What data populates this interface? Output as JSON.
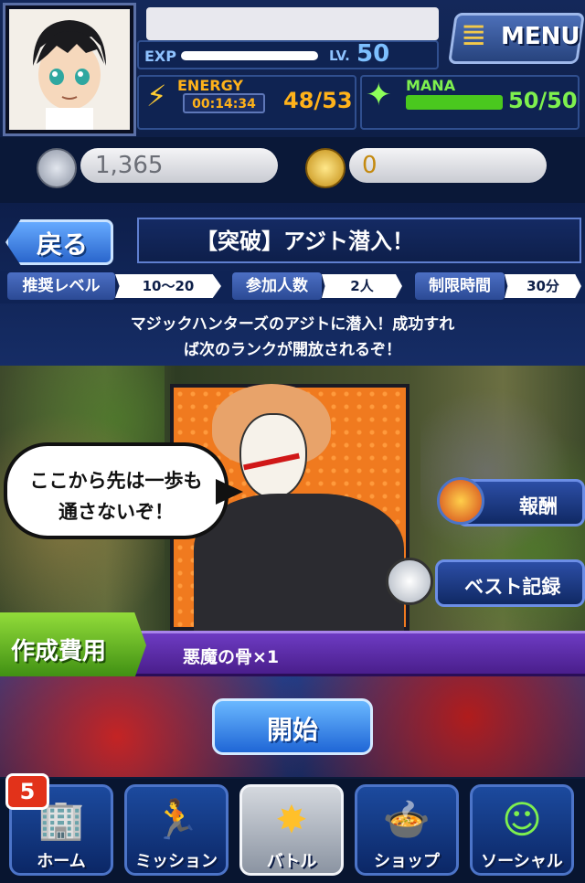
{
  "status": {
    "exp_label": "EXP",
    "level_label": "LV.",
    "level": "50",
    "energy_label": "ENERGY",
    "energy_timer": "00:14:34",
    "energy_value": "48/53",
    "mana_label": "MANA",
    "mana_value": "50/50",
    "menu_label": "MENU"
  },
  "currency": {
    "silver": "1,365",
    "gold": "0"
  },
  "quest": {
    "back_label": "戻る",
    "title": "【突破】アジト潜入！",
    "stats": [
      {
        "label": "推奨レベル",
        "value": "10〜20"
      },
      {
        "label": "参加人数",
        "value": "2人"
      },
      {
        "label": "制限時間",
        "value": "30分"
      }
    ],
    "description_line1": "マジックハンターズのアジトに潜入！成功すれ",
    "description_line2": "ば次のランクが開放されるぞ！"
  },
  "scene": {
    "speech_line1": "ここから先は一歩も",
    "speech_line2": "通さないぞ！",
    "reward_label": "報酬",
    "best_record_label": "ベスト記録"
  },
  "cost": {
    "label": "作成費用",
    "item": "悪魔の骨×1"
  },
  "start_label": "開始",
  "nav": {
    "badge": "5",
    "items": [
      {
        "label": "ホーム",
        "icon": "home-icon"
      },
      {
        "label": "ミッション",
        "icon": "mission-icon"
      },
      {
        "label": "バトル",
        "icon": "battle-icon"
      },
      {
        "label": "ショップ",
        "icon": "shop-icon"
      },
      {
        "label": "ソーシャル",
        "icon": "social-icon"
      }
    ]
  },
  "colors": {
    "energy": "#ffb21a",
    "mana": "#7ef04e",
    "cost_bar": "#5a2aa6",
    "start_button": "#2b7be6"
  }
}
